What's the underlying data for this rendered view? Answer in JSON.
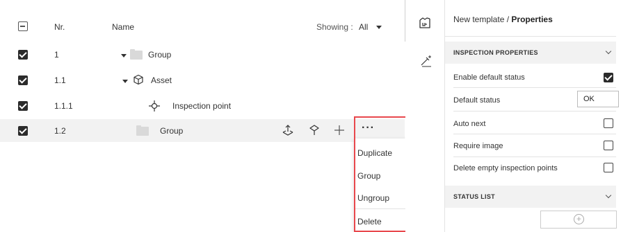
{
  "tree": {
    "header": {
      "nr_label": "Nr.",
      "name_label": "Name",
      "showing_label": "Showing :",
      "showing_value": "All"
    },
    "rows": [
      {
        "nr": "1",
        "name": "Group",
        "checked": true
      },
      {
        "nr": "1.1",
        "name": "Asset",
        "checked": true
      },
      {
        "nr": "1.1.1",
        "name": "Inspection point",
        "checked": true
      },
      {
        "nr": "1.2",
        "name": "Group",
        "checked": true
      }
    ],
    "row_actions": [
      "inspection-point-add-icon",
      "asset-add-icon",
      "plus-icon",
      "more-icon"
    ]
  },
  "context_menu": {
    "items": [
      "Duplicate",
      "Group",
      "Ungroup",
      "Delete"
    ]
  },
  "properties": {
    "breadcrumb_first": "New template",
    "breadcrumb_separator": "/",
    "breadcrumb_current": "Properties",
    "inspection_section": "INSPECTION PROPERTIES",
    "enable_default_status_label": "Enable default status",
    "enable_default_status": true,
    "default_status_label": "Default status",
    "default_status_value": "OK",
    "auto_next_label": "Auto next",
    "require_image_label": "Require image",
    "delete_empty_label": "Delete empty inspection points",
    "status_list_section": "STATUS LIST",
    "add_symbol": "+"
  }
}
